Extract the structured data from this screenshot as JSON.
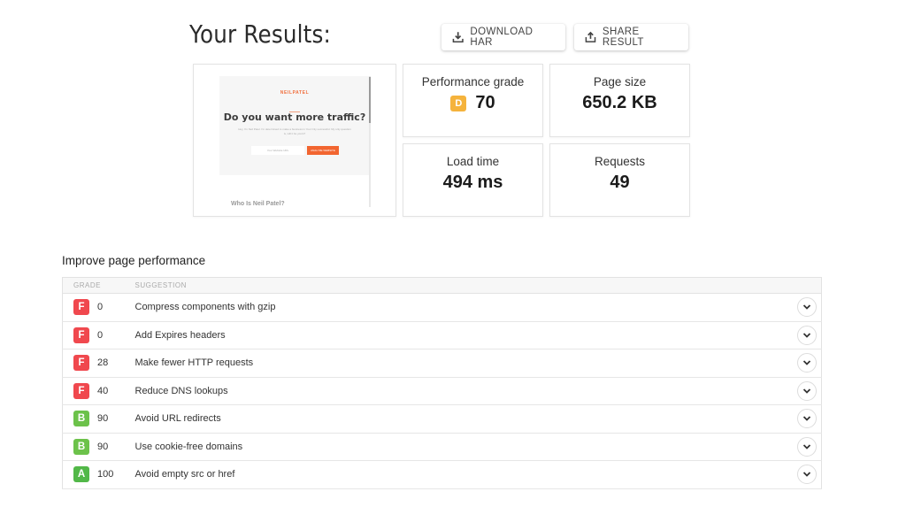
{
  "header": {
    "title": "Your Results:",
    "download_label": "DOWNLOAD HAR",
    "share_label": "SHARE RESULT"
  },
  "preview": {
    "logo": "NEILPATEL",
    "headline": "Do you want more traffic?",
    "subtext": "Hey, I'm Neil Patel. I'm determined to make a business in Your City successful. My only question is, will it be yours?",
    "input_placeholder": "Your Website URL",
    "button_label": "ANALYZE WEBSITE",
    "footer_heading": "Who Is Neil Patel?"
  },
  "metrics": {
    "performance": {
      "label": "Performance grade",
      "grade": "D",
      "value": "70",
      "grade_color": "#f5b33c"
    },
    "page_size": {
      "label": "Page size",
      "value": "650.2 KB"
    },
    "load_time": {
      "label": "Load time",
      "value": "494 ms"
    },
    "requests": {
      "label": "Requests",
      "value": "49"
    }
  },
  "improve": {
    "title": "Improve page performance",
    "columns": {
      "grade": "GRADE",
      "suggestion": "SUGGESTION"
    },
    "rows": [
      {
        "grade": "F",
        "score": "0",
        "suggestion": "Compress components with gzip",
        "color": "#f0484e"
      },
      {
        "grade": "F",
        "score": "0",
        "suggestion": "Add Expires headers",
        "color": "#f0484e"
      },
      {
        "grade": "F",
        "score": "28",
        "suggestion": "Make fewer HTTP requests",
        "color": "#f0484e"
      },
      {
        "grade": "F",
        "score": "40",
        "suggestion": "Reduce DNS lookups",
        "color": "#f0484e"
      },
      {
        "grade": "B",
        "score": "90",
        "suggestion": "Avoid URL redirects",
        "color": "#6cc24a"
      },
      {
        "grade": "B",
        "score": "90",
        "suggestion": "Use cookie-free domains",
        "color": "#6cc24a"
      },
      {
        "grade": "A",
        "score": "100",
        "suggestion": "Avoid empty src or href",
        "color": "#52b848"
      }
    ]
  }
}
